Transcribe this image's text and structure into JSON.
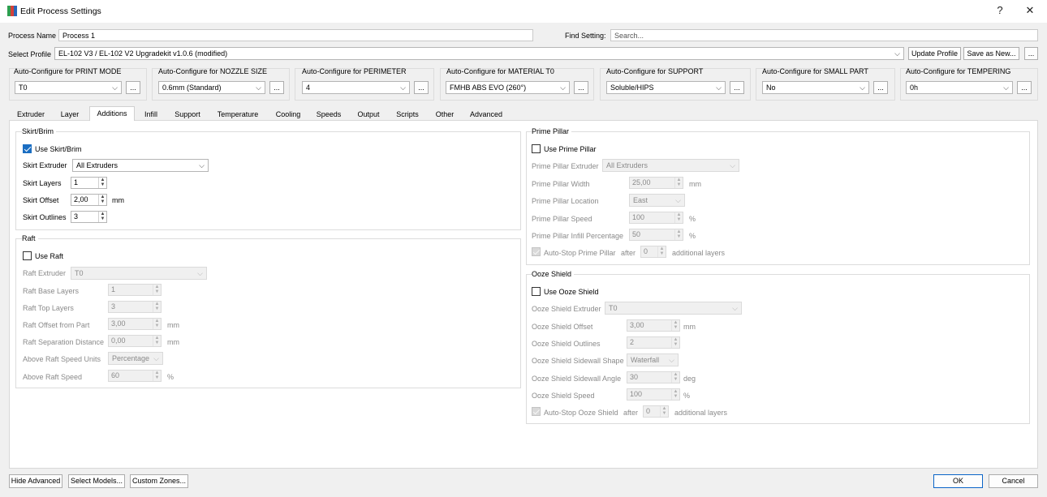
{
  "window": {
    "title": "Edit Process Settings",
    "help_label": "?",
    "close_label": "✕"
  },
  "process_name": {
    "label": "Process Name",
    "value": "Process 1"
  },
  "find_setting": {
    "label": "Find Setting:",
    "placeholder": "Search..."
  },
  "profile": {
    "label": "Select Profile",
    "value": "EL-102 V3 / EL-102 V2 Upgradekit v1.0.6 (modified)",
    "update_label": "Update Profile",
    "save_new_label": "Save as New...",
    "more_label": "..."
  },
  "autoconfig": [
    {
      "title": "Auto-Configure for PRINT MODE",
      "value": "T0"
    },
    {
      "title": "Auto-Configure for NOZZLE SIZE",
      "value": "0.6mm (Standard)"
    },
    {
      "title": "Auto-Configure for PERIMETER",
      "value": "4"
    },
    {
      "title": "Auto-Configure for MATERIAL T0",
      "value": "FMHB ABS EVO (260°)"
    },
    {
      "title": "Auto-Configure for SUPPORT",
      "value": "Soluble/HIPS"
    },
    {
      "title": "Auto-Configure for SMALL PART",
      "value": "No"
    },
    {
      "title": "Auto-Configure for TEMPERING",
      "value": "0h"
    }
  ],
  "ellipsis": "...",
  "tabs": [
    "Extruder",
    "Layer",
    "Additions",
    "Infill",
    "Support",
    "Temperature",
    "Cooling",
    "Speeds",
    "Output",
    "Scripts",
    "Other",
    "Advanced"
  ],
  "active_tab": "Additions",
  "skirt": {
    "title": "Skirt/Brim",
    "use_label": "Use Skirt/Brim",
    "use_checked": true,
    "extruder_label": "Skirt Extruder",
    "extruder_value": "All Extruders",
    "layers_label": "Skirt Layers",
    "layers_value": "1",
    "offset_label": "Skirt Offset",
    "offset_value": "2,00",
    "offset_unit": "mm",
    "outlines_label": "Skirt Outlines",
    "outlines_value": "3"
  },
  "raft": {
    "title": "Raft",
    "use_label": "Use Raft",
    "use_checked": false,
    "extruder_label": "Raft Extruder",
    "extruder_value": "T0",
    "base_label": "Raft Base Layers",
    "base_value": "1",
    "top_label": "Raft Top Layers",
    "top_value": "3",
    "offset_label": "Raft Offset from Part",
    "offset_value": "3,00",
    "offset_unit": "mm",
    "sep_label": "Raft Separation Distance",
    "sep_value": "0,00",
    "sep_unit": "mm",
    "speed_units_label": "Above Raft Speed Units",
    "speed_units_value": "Percentage",
    "speed_label": "Above Raft Speed",
    "speed_value": "60",
    "speed_unit": "%"
  },
  "prime": {
    "title": "Prime Pillar",
    "use_label": "Use Prime Pillar",
    "use_checked": false,
    "extruder_label": "Prime Pillar Extruder",
    "extruder_value": "All Extruders",
    "width_label": "Prime Pillar Width",
    "width_value": "25,00",
    "width_unit": "mm",
    "location_label": "Prime Pillar Location",
    "location_value": "East",
    "speed_label": "Prime Pillar Speed",
    "speed_value": "100",
    "speed_unit": "%",
    "infill_label": "Prime Pillar Infill Percentage",
    "infill_value": "50",
    "infill_unit": "%",
    "autostop_label": "Auto-Stop Prime Pillar",
    "autostop_after": "after",
    "autostop_value": "0",
    "autostop_suffix": "additional layers"
  },
  "ooze": {
    "title": "Ooze Shield",
    "use_label": "Use Ooze Shield",
    "use_checked": false,
    "extruder_label": "Ooze Shield Extruder",
    "extruder_value": "T0",
    "offset_label": "Ooze Shield Offset",
    "offset_value": "3,00",
    "offset_unit": "mm",
    "outlines_label": "Ooze Shield Outlines",
    "outlines_value": "2",
    "shape_label": "Ooze Shield Sidewall Shape",
    "shape_value": "Waterfall",
    "angle_label": "Ooze Shield Sidewall Angle",
    "angle_value": "30",
    "angle_unit": "deg",
    "speed_label": "Ooze Shield Speed",
    "speed_value": "100",
    "speed_unit": "%",
    "autostop_label": "Auto-Stop Ooze Shield",
    "autostop_after": "after",
    "autostop_value": "0",
    "autostop_suffix": "additional layers"
  },
  "footer": {
    "hide_advanced": "Hide Advanced",
    "select_models": "Select Models...",
    "custom_zones": "Custom Zones...",
    "ok": "OK",
    "cancel": "Cancel"
  },
  "colors": {
    "accent": "#1b6ec2",
    "ok_border": "#0a64c8",
    "app_icon": [
      "#2e9e4f",
      "#d4403a",
      "#2966b8"
    ]
  }
}
